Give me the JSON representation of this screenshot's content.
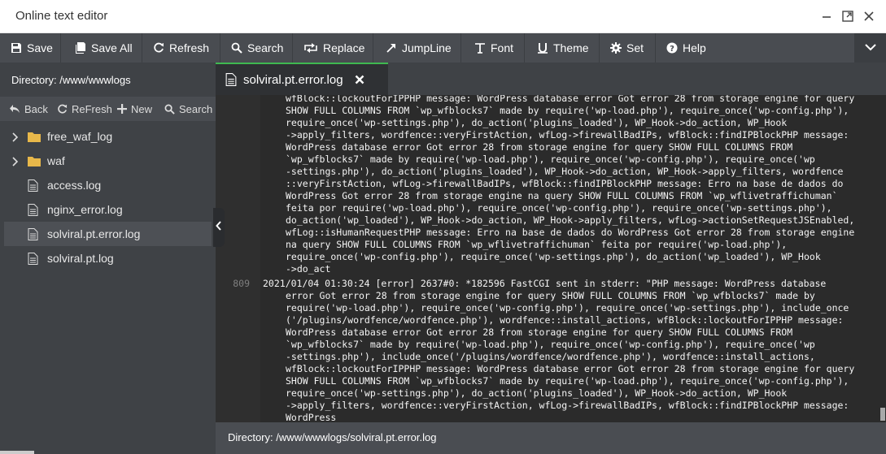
{
  "window": {
    "title": "Online text editor"
  },
  "toolbar": {
    "items": [
      {
        "label": "Save",
        "icon": "floppy-icon"
      },
      {
        "label": "Save All",
        "icon": "save-all-icon"
      },
      {
        "label": "Refresh",
        "icon": "refresh-icon"
      },
      {
        "label": "Search",
        "icon": "search-icon"
      },
      {
        "label": "Replace",
        "icon": "replace-icon"
      },
      {
        "label": "JumpLine",
        "icon": "jump-line-icon"
      },
      {
        "label": "Font",
        "icon": "font-icon"
      },
      {
        "label": "Theme",
        "icon": "theme-icon"
      },
      {
        "label": "Set",
        "icon": "gear-icon"
      },
      {
        "label": "Help",
        "icon": "help-icon"
      }
    ]
  },
  "sidebar": {
    "directory_label": "Directory: /www/wwwlogs",
    "tools": {
      "back": "Back",
      "refresh": "ReFresh",
      "new": "New",
      "search": "Search"
    },
    "files": [
      {
        "name": "free_waf_log",
        "type": "folder"
      },
      {
        "name": "waf",
        "type": "folder"
      },
      {
        "name": "access.log",
        "type": "file"
      },
      {
        "name": "nginx_error.log",
        "type": "file"
      },
      {
        "name": "solviral.pt.error.log",
        "type": "file",
        "selected": true
      },
      {
        "name": "solviral.pt.log",
        "type": "file"
      }
    ]
  },
  "editor": {
    "tab_label": "solviral.pt.error.log",
    "line_number": "809",
    "lines": [
      "wfBlock::lockoutForIPPHP message: WordPress database error Got error 28 from storage engine for query",
      "SHOW FULL COLUMNS FROM `wp_wfblocks7` made by require('wp-load.php'), require_once('wp-config.php'),",
      "require_once('wp-settings.php'), do_action('plugins_loaded'), WP_Hook->do_action, WP_Hook",
      "->apply_filters, wordfence::veryFirstAction, wfLog->firewallBadIPs, wfBlock::findIPBlockPHP message:",
      "WordPress database error Got error 28 from storage engine for query SHOW FULL COLUMNS FROM",
      "`wp_wfblocks7` made by require('wp-load.php'), require_once('wp-config.php'), require_once('wp",
      "-settings.php'), do_action('plugins_loaded'), WP_Hook->do_action, WP_Hook->apply_filters, wordfence",
      "::veryFirstAction, wfLog->firewallBadIPs, wfBlock::findIPBlockPHP message: Erro na base de dados do",
      "WordPress Got error 28 from storage engine na query SHOW FULL COLUMNS FROM `wp_wflivetraffichuman`",
      "feita por require('wp-load.php'), require_once('wp-config.php'), require_once('wp-settings.php'),",
      "do_action('wp_loaded'), WP_Hook->do_action, WP_Hook->apply_filters, wfLog->actionSetRequestJSEnabled,",
      "wfLog::isHumanRequestPHP message: Erro na base de dados do WordPress Got error 28 from storage engine",
      "na query SHOW FULL COLUMNS FROM `wp_wflivetraffichuman` feita por require('wp-load.php'),",
      "require_once('wp-config.php'), require_once('wp-settings.php'), do_action('wp_loaded'), WP_Hook",
      "->do_act",
      "2021/01/04 01:30:24 [error] 2637#0: *182596 FastCGI sent in stderr: \"PHP message: WordPress database",
      "error Got error 28 from storage engine for query SHOW FULL COLUMNS FROM `wp_wfblocks7` made by",
      "require('wp-load.php'), require_once('wp-config.php'), require_once('wp-settings.php'), include_once",
      "('/plugins/wordfence/wordfence.php'), wordfence::install_actions, wfBlock::lockoutForIPPHP message:",
      "WordPress database error Got error 28 from storage engine for query SHOW FULL COLUMNS FROM",
      "`wp_wfblocks7` made by require('wp-load.php'), require_once('wp-config.php'), require_once('wp",
      "-settings.php'), include_once('/plugins/wordfence/wordfence.php'), wordfence::install_actions,",
      "wfBlock::lockoutForIPPHP message: WordPress database error Got error 28 from storage engine for query",
      "SHOW FULL COLUMNS FROM `wp_wfblocks7` made by require('wp-load.php'), require_once('wp-config.php'),",
      "require_once('wp-settings.php'), do_action('plugins_loaded'), WP_Hook->do_action, WP_Hook",
      "->apply_filters, wordfence::veryFirstAction, wfLog->firewallBadIPs, wfBlock::findIPBlockPHP message:",
      "WordPress"
    ]
  },
  "status": {
    "directory": "Directory: /www/wwwlogs/solviral.pt.error.log"
  },
  "colors": {
    "toolbar_bg": "#494c51",
    "sidebar_bg": "#3f4246",
    "editor_bg": "#2b2b2b",
    "tab_accent": "#3fb950",
    "folder": "#e8b84a"
  }
}
